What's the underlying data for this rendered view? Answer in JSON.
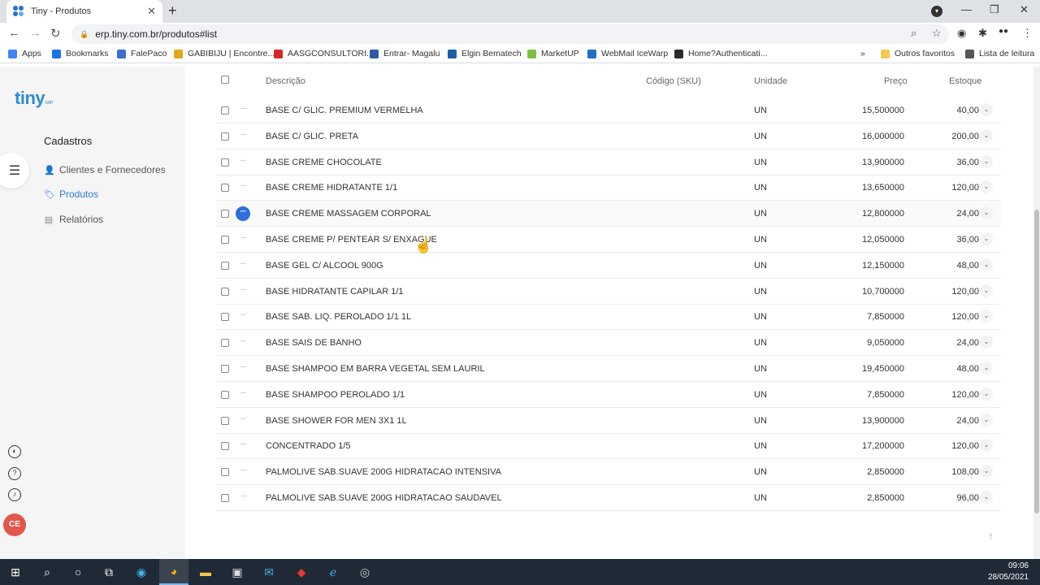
{
  "browser": {
    "tab_title": "Tiny - Produtos",
    "tab_close": "✕",
    "new_tab": "+",
    "url": "erp.tiny.com.br/produtos#list",
    "window_controls": [
      "—",
      "❐",
      "✕"
    ]
  },
  "bookmarks": [
    {
      "label": "Apps",
      "color": "#4285f4"
    },
    {
      "label": "Bookmarks",
      "color": "#1a73e8"
    },
    {
      "label": "FalePaco",
      "color": "#3b6fc9"
    },
    {
      "label": "GABIBIJU | Encontre...",
      "color": "#e0a91b"
    },
    {
      "label": "AASGCONSULTORI...",
      "color": "#d62828"
    },
    {
      "label": "Entrar- Magalu",
      "color": "#2d5aa8"
    },
    {
      "label": "Elgin Bematech",
      "color": "#1b5fa8"
    },
    {
      "label": "MarketUP",
      "color": "#7cc242"
    },
    {
      "label": "WebMail IceWarp",
      "color": "#1f6fc5"
    },
    {
      "label": "Home?Authenticati...",
      "color": "#2a2a2a"
    },
    {
      "label": "Outros favoritos",
      "color": "#f2c94c"
    },
    {
      "label": "Lista de leitura",
      "color": "#555555"
    }
  ],
  "bookmarks_more": "»",
  "app": {
    "logo": "tiny",
    "logo_sub": "ERP",
    "section_title": "Cadastros",
    "nav": [
      {
        "label": "Clientes e Fornecedores",
        "icon": "person-icon",
        "active": false
      },
      {
        "label": "Produtos",
        "icon": "tag-icon",
        "active": true
      },
      {
        "label": "Relatórios",
        "icon": "report-icon",
        "active": false
      }
    ],
    "avatar_initials": "CE"
  },
  "table": {
    "headers": {
      "description": "Descrição",
      "sku": "Código (SKU)",
      "unit": "Unidade",
      "price": "Preço",
      "stock": "Estoque"
    },
    "rows": [
      {
        "description": "BASE C/ GLIC. PREMIUM VERMELHA",
        "sku": "",
        "unit": "UN",
        "price": "15,500000",
        "stock": "40,00"
      },
      {
        "description": "BASE C/ GLIC. PRETA",
        "sku": "",
        "unit": "UN",
        "price": "16,000000",
        "stock": "200,00"
      },
      {
        "description": "BASE CREME CHOCOLATE",
        "sku": "",
        "unit": "UN",
        "price": "13,900000",
        "stock": "36,00"
      },
      {
        "description": "BASE CREME HIDRATANTE 1/1",
        "sku": "",
        "unit": "UN",
        "price": "13,650000",
        "stock": "120,00"
      },
      {
        "description": "BASE CREME MASSAGEM CORPORAL",
        "sku": "",
        "unit": "UN",
        "price": "12,800000",
        "stock": "24,00"
      },
      {
        "description": "BASE CREME P/ PENTEAR S/ ENXAGUE",
        "sku": "",
        "unit": "UN",
        "price": "12,050000",
        "stock": "36,00"
      },
      {
        "description": "BASE GEL C/ ALCOOL 900G",
        "sku": "",
        "unit": "UN",
        "price": "12,150000",
        "stock": "48,00"
      },
      {
        "description": "BASE HIDRATANTE CAPILAR 1/1",
        "sku": "",
        "unit": "UN",
        "price": "10,700000",
        "stock": "120,00"
      },
      {
        "description": "BASE SAB. LIQ. PEROLADO 1/1 1L",
        "sku": "",
        "unit": "UN",
        "price": "7,850000",
        "stock": "120,00"
      },
      {
        "description": "BASE SAIS DE BANHO",
        "sku": "",
        "unit": "UN",
        "price": "9,050000",
        "stock": "24,00"
      },
      {
        "description": "BASE SHAMPOO EM BARRA VEGETAL SEM LAURIL",
        "sku": "",
        "unit": "UN",
        "price": "19,450000",
        "stock": "48,00"
      },
      {
        "description": "BASE SHAMPOO PEROLADO 1/1",
        "sku": "",
        "unit": "UN",
        "price": "7,850000",
        "stock": "120,00"
      },
      {
        "description": "BASE SHOWER FOR MEN 3X1 1L",
        "sku": "",
        "unit": "UN",
        "price": "13,900000",
        "stock": "24,00"
      },
      {
        "description": "CONCENTRADO 1/5",
        "sku": "",
        "unit": "UN",
        "price": "17,200000",
        "stock": "120,00"
      },
      {
        "description": "PALMOLIVE SAB.SUAVE 200G HIDRATACAO INTENSIVA",
        "sku": "",
        "unit": "UN",
        "price": "2,850000",
        "stock": "108,00"
      },
      {
        "description": "PALMOLIVE SAB.SUAVE 200G HIDRATACAO SAUDAVEL",
        "sku": "",
        "unit": "UN",
        "price": "2,850000",
        "stock": "96,00"
      }
    ],
    "active_row": 4,
    "row_actions": "···",
    "expand_icon": "⌄"
  },
  "taskbar": {
    "time": "09:06",
    "date": "28/05/2021"
  },
  "colors": {
    "accent": "#2e7bd6",
    "active_dots": "#2e6fd9",
    "avatar": "#e2574c",
    "taskbar": "#1f2a36"
  }
}
